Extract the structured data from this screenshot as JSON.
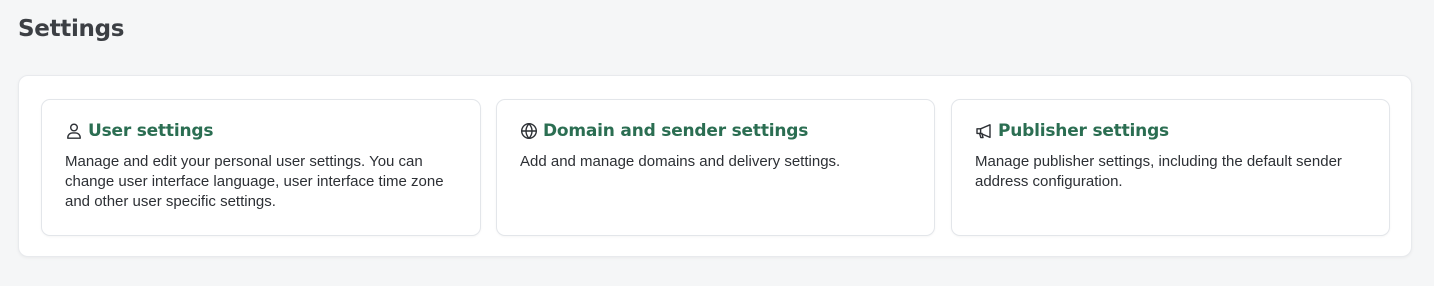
{
  "page": {
    "title": "Settings"
  },
  "cards": [
    {
      "title": "User settings",
      "description": "Manage and edit your personal user settings. You can change user interface language, user interface time zone and other user specific settings.",
      "icon": "user-icon"
    },
    {
      "title": "Domain and sender settings",
      "description": "Add and manage domains and delivery settings.",
      "icon": "globe-icon"
    },
    {
      "title": "Publisher settings",
      "description": "Manage publisher settings, including the default sender address configuration.",
      "icon": "megaphone-icon"
    }
  ],
  "colors": {
    "background": "#f5f6f7",
    "card_title": "#2b6e52",
    "heading": "#3c3f44",
    "text": "#2d3035"
  }
}
